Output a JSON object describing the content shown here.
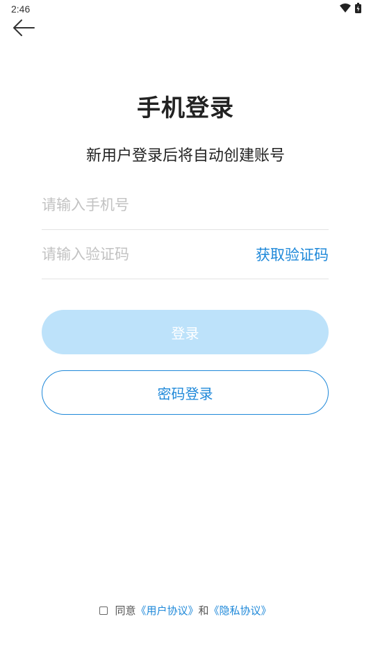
{
  "status_bar": {
    "time": "2:46",
    "icons": [
      "wifi-icon",
      "battery-icon"
    ]
  },
  "nav": {
    "back_icon": "arrow-left-icon"
  },
  "header": {
    "title": "手机登录",
    "subtitle": "新用户登录后将自动创建账号"
  },
  "form": {
    "phone_placeholder": "请输入手机号",
    "phone_value": "",
    "code_placeholder": "请输入验证码",
    "code_value": "",
    "get_code_label": "获取验证码"
  },
  "actions": {
    "login_label": "登录",
    "password_login_label": "密码登录"
  },
  "agreement": {
    "prefix": "同意",
    "user_agreement": "《用户协议》",
    "conjunction": "和",
    "privacy_policy": "《隐私协议》",
    "checked": false
  },
  "colors": {
    "accent": "#1e88d9",
    "login_disabled_bg": "#bde2fa",
    "placeholder": "#c2c2c2",
    "divider": "#e3e3e3"
  }
}
